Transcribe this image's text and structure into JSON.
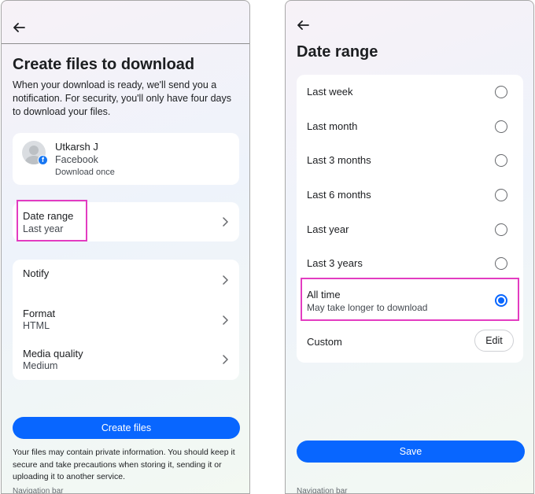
{
  "left_screen": {
    "title": "Create files to download",
    "intro": "When your download is ready, we'll send you a notification. For security, you'll only have four days to download your files.",
    "account": {
      "name": "Utkarsh J",
      "platform": "Facebook",
      "note": "Download once"
    },
    "date_range": {
      "label": "Date range",
      "value": "Last year"
    },
    "options": [
      {
        "label": "Notify",
        "value": ""
      },
      {
        "label": "Format",
        "value": "HTML"
      },
      {
        "label": "Media quality",
        "value": "Medium"
      }
    ],
    "create_button": "Create files",
    "disclaimer": "Your files may contain private information. You should keep it secure and take precautions when storing it, sending it or uploading it to another service.",
    "navbar_peek": "Navigation bar"
  },
  "right_screen": {
    "title": "Date range",
    "ranges": [
      {
        "label": "Last week",
        "sub": "",
        "selected": false
      },
      {
        "label": "Last month",
        "sub": "",
        "selected": false
      },
      {
        "label": "Last 3 months",
        "sub": "",
        "selected": false
      },
      {
        "label": "Last 6 months",
        "sub": "",
        "selected": false
      },
      {
        "label": "Last year",
        "sub": "",
        "selected": false
      },
      {
        "label": "Last 3 years",
        "sub": "",
        "selected": false
      },
      {
        "label": "All time",
        "sub": "May take longer to download",
        "selected": true
      }
    ],
    "custom_label": "Custom",
    "edit_button": "Edit",
    "save_button": "Save",
    "navbar_peek": "Navigation bar"
  },
  "colors": {
    "accent": "#0866ff",
    "highlight": "#e33cc1",
    "facebook": "#1877f2"
  },
  "icons": [
    "back-arrow-icon",
    "chevron-right-icon",
    "facebook-icon",
    "radio-icon"
  ]
}
